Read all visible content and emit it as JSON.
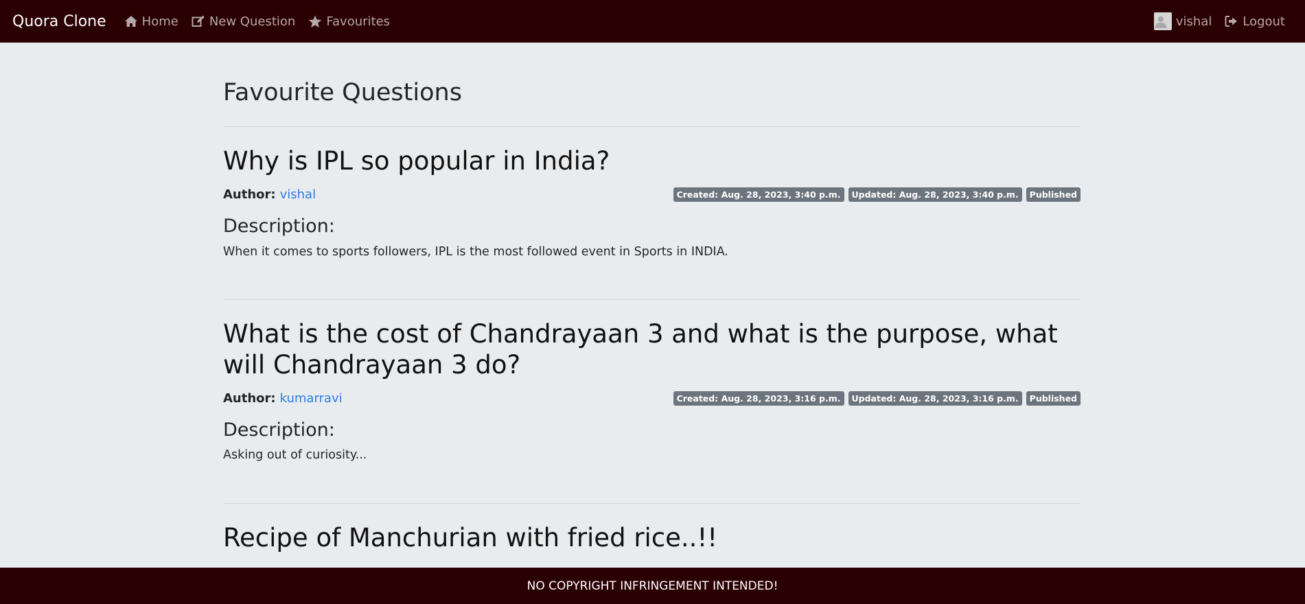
{
  "navbar": {
    "brand": "Quora Clone",
    "links": [
      {
        "label": "Home",
        "icon": "home-icon"
      },
      {
        "label": "New Question",
        "icon": "edit-icon"
      },
      {
        "label": "Favourites",
        "icon": "star-icon"
      }
    ],
    "user": "vishal",
    "logout": "Logout"
  },
  "page": {
    "title": "Favourite Questions"
  },
  "questions": [
    {
      "title": "Why is IPL so popular in India?",
      "author_label": "Author:",
      "author": "vishal",
      "created": "Created: Aug. 28, 2023, 3:40 p.m.",
      "updated": "Updated: Aug. 28, 2023, 3:40 p.m.",
      "status": "Published",
      "desc_heading": "Description:",
      "description": "When it comes to sports followers, IPL is the most followed event in Sports in INDIA."
    },
    {
      "title": "What is the cost of Chandrayaan 3 and what is the purpose, what will Chandrayaan 3 do?",
      "author_label": "Author:",
      "author": "kumarravi",
      "created": "Created: Aug. 28, 2023, 3:16 p.m.",
      "updated": "Updated: Aug. 28, 2023, 3:16 p.m.",
      "status": "Published",
      "desc_heading": "Description:",
      "description": "Asking out of curiosity..."
    },
    {
      "title": "Recipe of Manchurian with fried rice..!!"
    }
  ],
  "footer": {
    "text": "NO COPYRIGHT INFRINGEMENT INTENDED!"
  },
  "colors": {
    "navbar_bg": "#2b0003",
    "page_bg": "#e9ecef",
    "link": "#2c7be5",
    "badge_bg": "#6c757d"
  }
}
